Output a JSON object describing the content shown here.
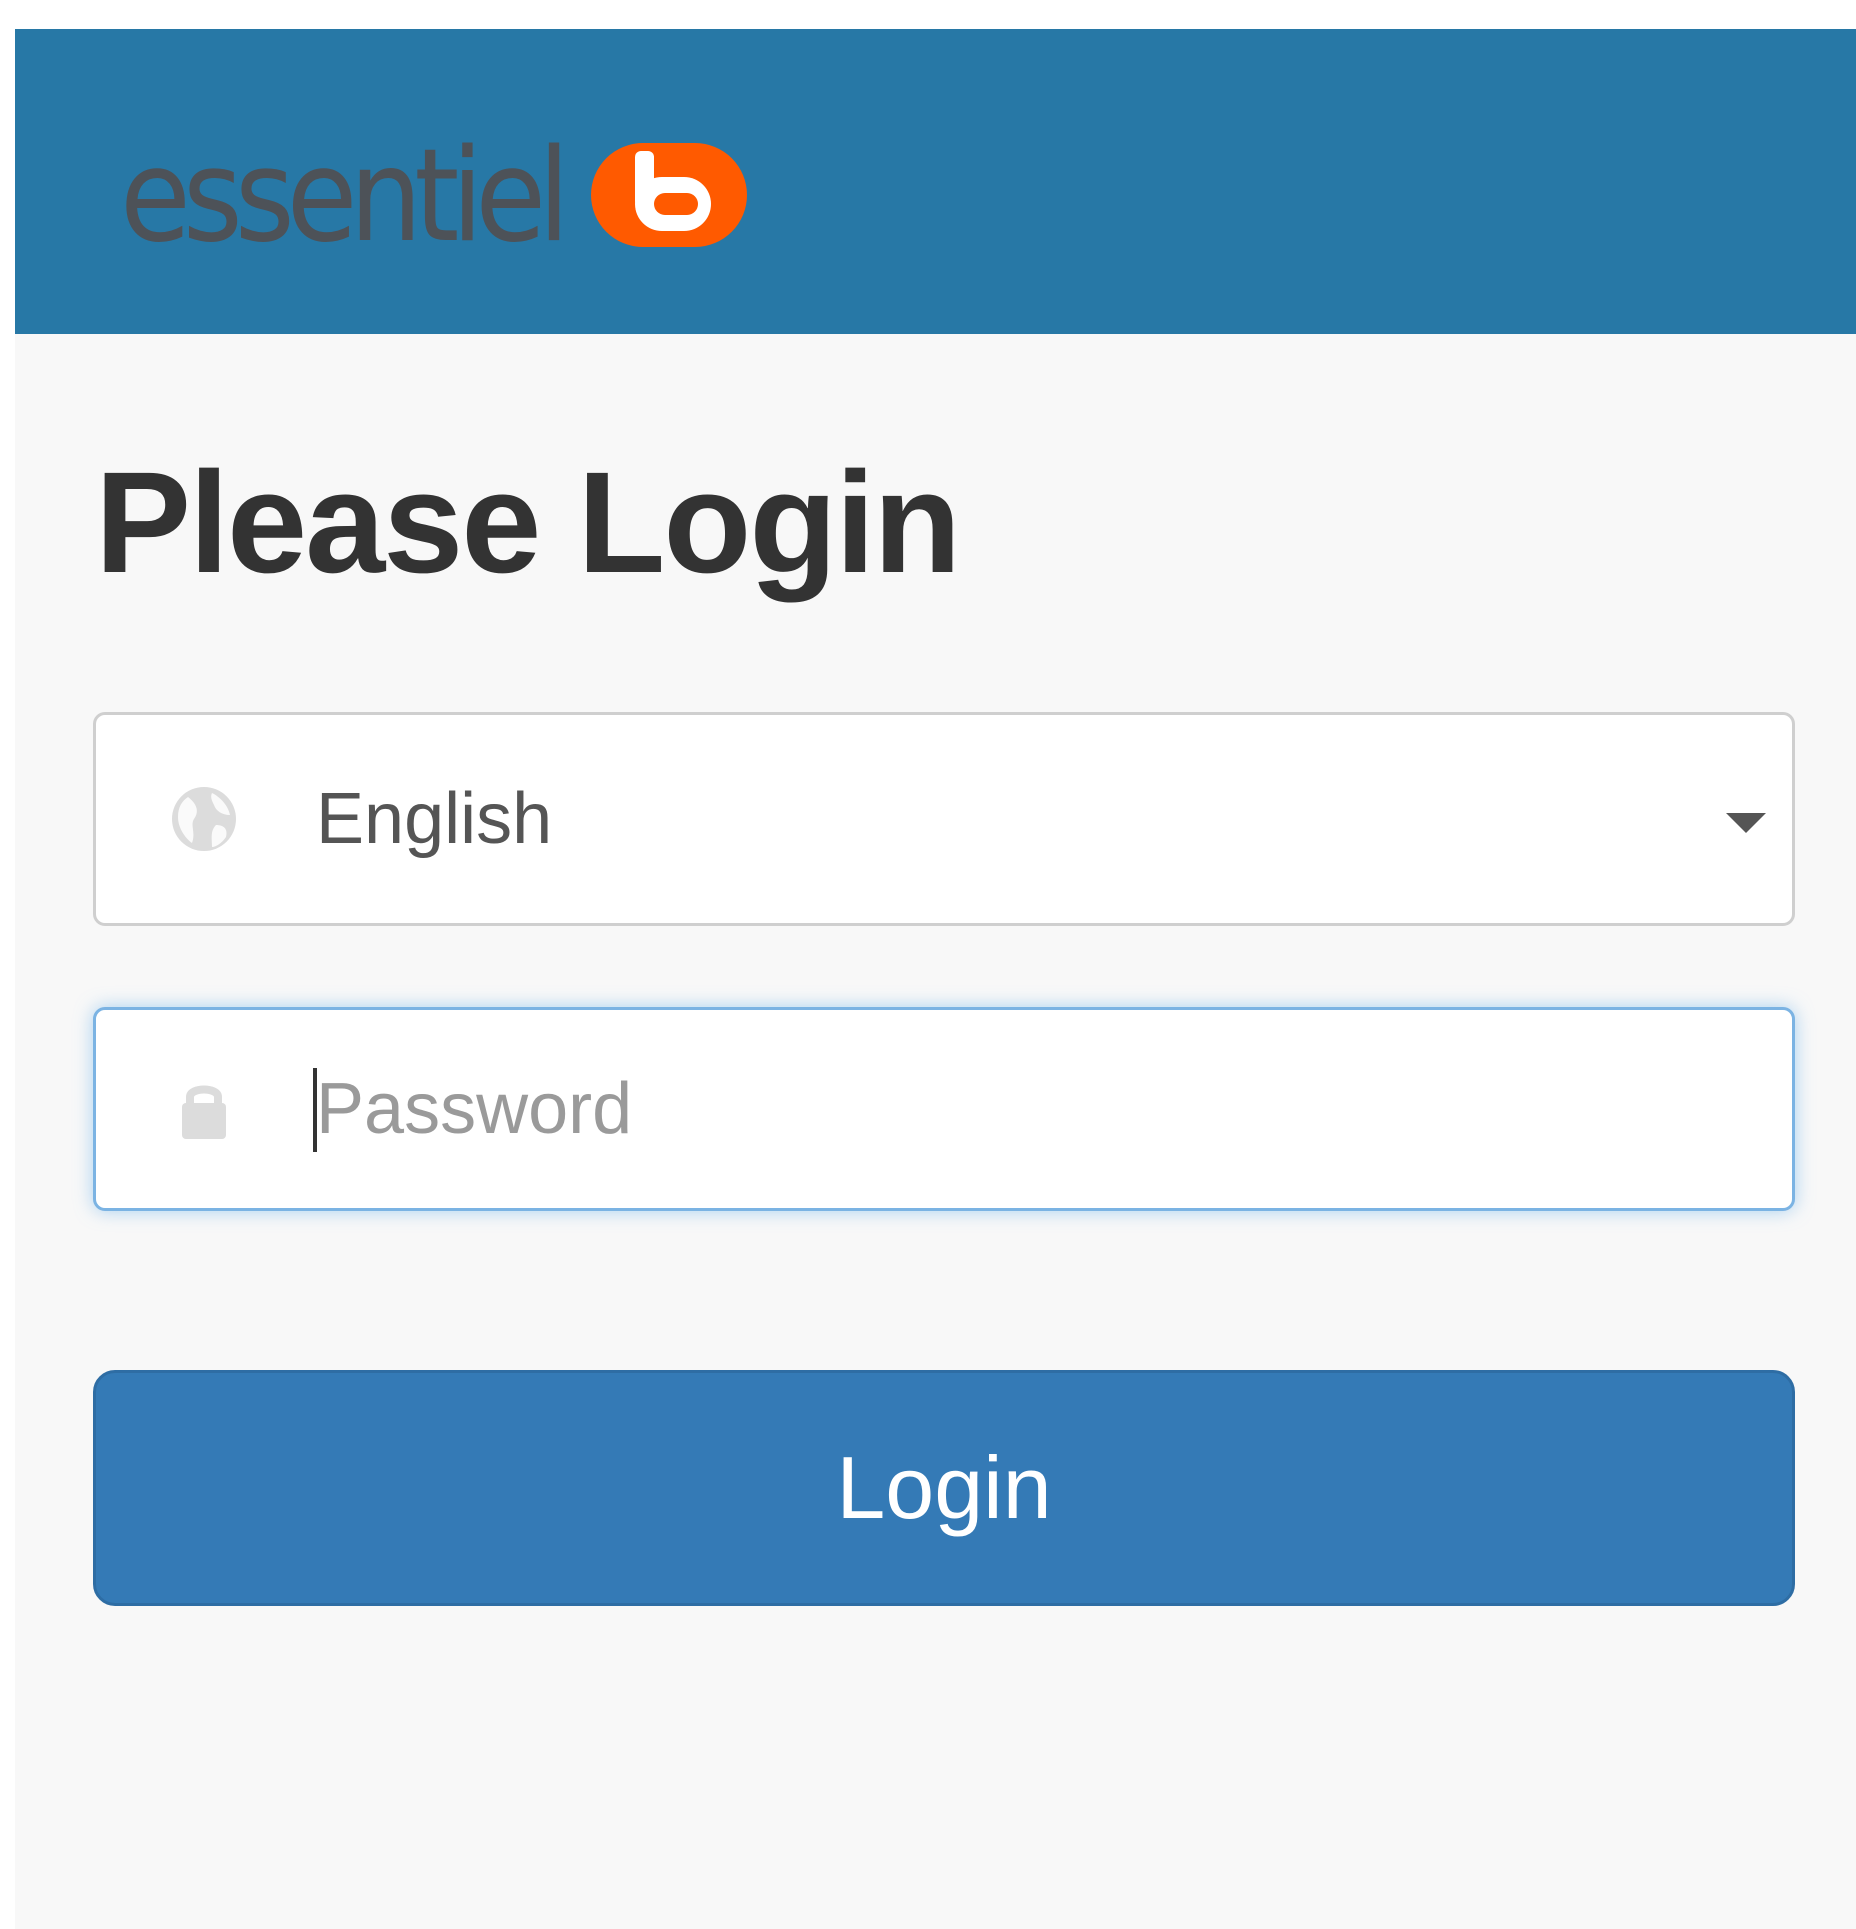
{
  "header": {
    "brand_text": "essentiel",
    "brand_badge_letter": "b",
    "background_color": "#2778a6",
    "badge_color": "#ff5a00"
  },
  "page": {
    "title": "Please Login"
  },
  "language": {
    "icon": "globe-icon",
    "selected": "English"
  },
  "password": {
    "icon": "lock-icon",
    "placeholder": "Password",
    "value": ""
  },
  "login_button": {
    "label": "Login",
    "color": "#347ab6"
  }
}
